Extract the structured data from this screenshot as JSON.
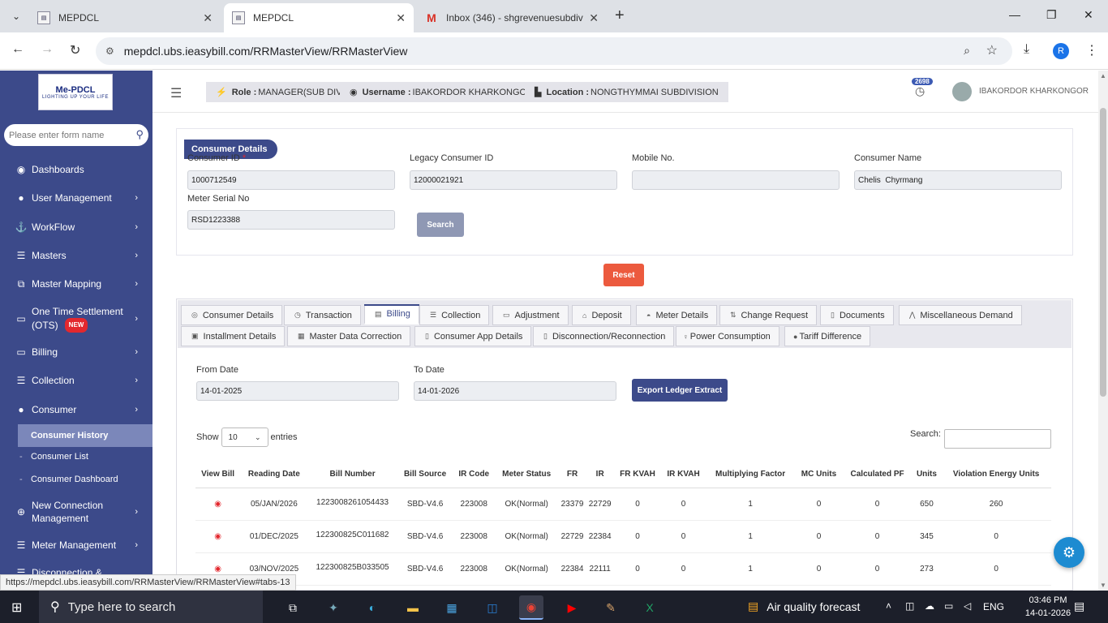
{
  "browser": {
    "tabs": [
      {
        "label": "MEPDCL",
        "active": false
      },
      {
        "label": "MEPDCL",
        "active": true
      },
      {
        "label": "Inbox (346) - shgrevenuesubdiv",
        "active": false
      }
    ],
    "url": "mepdcl.ubs.ieasybill.com/RRMasterView/RRMasterView",
    "profile_initial": "R",
    "status_url": "https://mepdcl.ubs.ieasybill.com/RRMasterView/RRMasterView#tabs-13"
  },
  "logo": {
    "title": "Me-PDCL",
    "tagline": "LIGHTING UP YOUR LIFE"
  },
  "sidebar": {
    "search_placeholder": "Please enter form name",
    "items": [
      {
        "label": "Dashboards",
        "icon": "palette-icon"
      },
      {
        "label": "User Management",
        "icon": "user-icon"
      },
      {
        "label": "WorkFlow",
        "icon": "anchor-icon"
      },
      {
        "label": "Masters",
        "icon": "list-icon"
      },
      {
        "label": "Master Mapping",
        "icon": "sitemap-icon"
      },
      {
        "label": "One Time Settlement",
        "label2": "(OTS)",
        "badge": "NEW",
        "icon": "desktop-icon"
      },
      {
        "label": "Billing",
        "icon": "monitor-icon"
      },
      {
        "label": "Collection",
        "icon": "list-icon"
      },
      {
        "label": "Consumer",
        "icon": "user-icon"
      },
      {
        "label": "New Connection",
        "label2": "Management",
        "icon": "plus-circle-icon"
      },
      {
        "label": "Meter Management",
        "icon": "list-icon"
      },
      {
        "label": "Disconnection &",
        "icon": "list-icon"
      }
    ],
    "consumer_sub": [
      "Consumer History",
      "Consumer List",
      "Consumer Dashboard"
    ]
  },
  "header": {
    "role_label": "Role :",
    "role_value": "MANAGER(SUB DIV)",
    "username_label": "Username :",
    "username_value": "IBAKORDOR KHARKONGOR",
    "location_label": "Location :",
    "location_value": "NONGTHYMMAI SUBDIVISION",
    "notif_count": "2698",
    "user_name": "IBAKORDOR KHARKONGOR"
  },
  "consumer_details": {
    "title": "Consumer Details",
    "fields": {
      "consumer_id": {
        "label": "Consumer ID",
        "required_mark": "*",
        "value": "1000712549"
      },
      "legacy_id": {
        "label": "Legacy Consumer ID",
        "value": "12000021921"
      },
      "mobile": {
        "label": "Mobile No.",
        "value": ""
      },
      "name": {
        "label": "Consumer Name",
        "value": "Chelis  Chyrmang"
      },
      "meter_serial": {
        "label": "Meter Serial No",
        "value": "RSD1223388"
      }
    },
    "search_button": "Search",
    "reset_button": "Reset"
  },
  "tabs": [
    {
      "label": "Consumer Details",
      "icon": "◎"
    },
    {
      "label": "Transaction",
      "icon": "◷"
    },
    {
      "label": "Billing",
      "icon": "▤"
    },
    {
      "label": "Collection",
      "icon": "☰"
    },
    {
      "label": "Adjustment",
      "icon": "▭"
    },
    {
      "label": "Deposit",
      "icon": "⌂"
    },
    {
      "label": "Meter Details",
      "icon": "◓"
    },
    {
      "label": "Change Request",
      "icon": "⇅"
    },
    {
      "label": "Documents",
      "icon": "▯"
    },
    {
      "label": "Miscellaneous Demand",
      "icon": "⋀"
    },
    {
      "label": "Installment Details",
      "icon": "▣"
    },
    {
      "label": "Master Data Correction",
      "icon": "▦"
    },
    {
      "label": "Consumer App Details",
      "icon": "▯"
    },
    {
      "label": "Disconnection/Reconnection",
      "icon": "▯"
    },
    {
      "label": "Power Consumption",
      "icon": "♀"
    },
    {
      "label": "Tariff Difference",
      "icon": "●"
    }
  ],
  "billing": {
    "from_label": "From Date",
    "from_value": "14-01-2025",
    "to_label": "To Date",
    "to_value": "14-01-2026",
    "export_button": "Export Ledger Extract",
    "show_label": "Show",
    "show_value": "10",
    "entries_label": "entries",
    "search_label": "Search:"
  },
  "table": {
    "columns": [
      "View Bill",
      "Reading Date",
      "Bill Number",
      "Bill Source",
      "IR Code",
      "Meter Status",
      "FR",
      "IR",
      "FR KVAH",
      "IR KVAH",
      "Multiplying Factor",
      "MC Units",
      "Calculated PF",
      "Units",
      "Violation Energy Units"
    ],
    "rows": [
      [
        "05/JAN/2026",
        "1223008261054433",
        "SBD-V4.6",
        "223008",
        "OK(Normal)",
        "23379",
        "22729",
        "0",
        "0",
        "1",
        "0",
        "0",
        "650",
        "260"
      ],
      [
        "01/DEC/2025",
        "122300825C011682",
        "SBD-V4.6",
        "223008",
        "OK(Normal)",
        "22729",
        "22384",
        "0",
        "0",
        "1",
        "0",
        "0",
        "345",
        "0"
      ],
      [
        "03/NOV/2025",
        "122300825B033505",
        "SBD-V4.6",
        "223008",
        "OK(Normal)",
        "22384",
        "22111",
        "0",
        "0",
        "1",
        "0",
        "0",
        "273",
        "0"
      ]
    ]
  },
  "taskbar": {
    "search_placeholder": "Type here to search",
    "weather": "Air quality forecast",
    "lang": "ENG",
    "time": "03:46 PM",
    "date": "14-01-2026"
  }
}
